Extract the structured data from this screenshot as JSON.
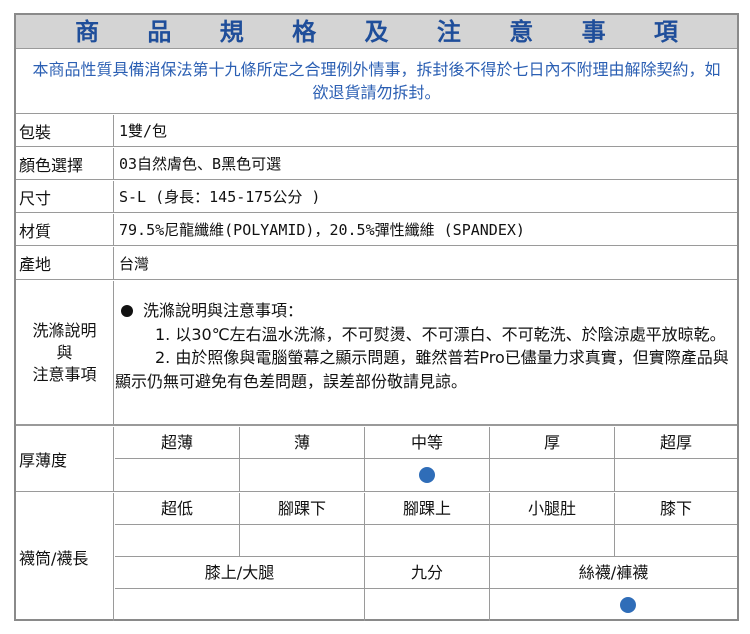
{
  "title": "商 品 規 格 及 注 意 事 項",
  "notice": "本商品性質具備消保法第十九條所定之合理例外情事，拆封後不得於七日內不附理由解除契約，如欲退貨請勿拆封。",
  "specs": [
    {
      "label": "包裝",
      "value": "1雙/包"
    },
    {
      "label": "顏色選擇",
      "value": "03自然膚色、B黑色可選"
    },
    {
      "label": "尺寸",
      "value": "S-L (身長：145-175公分 )"
    },
    {
      "label": "材質",
      "value": "79.5%尼龍纖維(POLYAMID)，20.5%彈性纖維 (SPANDEX)"
    },
    {
      "label": "產地",
      "value": "台灣"
    }
  ],
  "care": {
    "label_line1": "洗滌說明",
    "label_line2": "與",
    "label_line3": "注意事項",
    "heading": "洗滌說明與注意事項：",
    "item1": "1. 以30℃左右溫水洗滌，不可熨燙、不可漂白、不可乾洗、於陰涼處平放晾乾。",
    "item2": "2. 由於照像與電腦螢幕之顯示問題，雖然普若Pro已儘量力求真實，但實際產品與 顯示仍無可避免有色差問題，誤差部份敬請見諒。"
  },
  "thickness": {
    "label": "厚薄度",
    "options": [
      "超薄",
      "薄",
      "中等",
      "厚",
      "超厚"
    ],
    "selected": "中等"
  },
  "length": {
    "label": "襪筒/襪長",
    "options_row1": [
      "超低",
      "腳踝下",
      "腳踝上",
      "小腿肚",
      "膝下"
    ],
    "options_row2": [
      "膝上/大腿",
      "九分",
      "絲襪/褲襪"
    ],
    "selected": "絲襪/褲襪"
  },
  "colors": {
    "title_text": "#1f4e9a",
    "notice_text": "#2b5fb3",
    "dot": "#2f6db8",
    "title_bg": "#d4d4d4"
  }
}
